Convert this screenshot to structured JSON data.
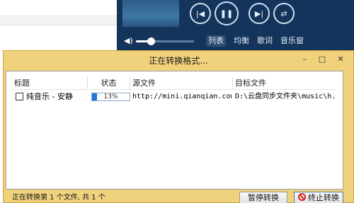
{
  "player": {
    "controls": [
      "prev-icon",
      "pause-icon",
      "next-icon",
      "shuffle-icon"
    ],
    "volume_level": 0.25,
    "tabs": [
      "列表",
      "均衡",
      "歌词",
      "音乐窗"
    ]
  },
  "dialog": {
    "title": "正在转换格式...",
    "window_buttons": {
      "minimize": "–",
      "maximize": "□",
      "close": "✕"
    },
    "columns": [
      "标题",
      "状态",
      "源文件",
      "目标文件"
    ],
    "rows": [
      {
        "title": "纯音乐 - 安静",
        "progress": "13%",
        "progress_value": 0.13,
        "source": "http://mini.qianqian.com/...",
        "target": "D:\\云盘同步文件夹\\music\\h..."
      }
    ],
    "status_text": "正在转换第 1 个文件, 共 1 个",
    "buttons": {
      "pause": "暂停转换",
      "stop": "终止转换"
    }
  },
  "colors": {
    "dialog_frame": "#f0d27c",
    "player_bg": "#14345c",
    "progress": "#1f7ad6"
  }
}
